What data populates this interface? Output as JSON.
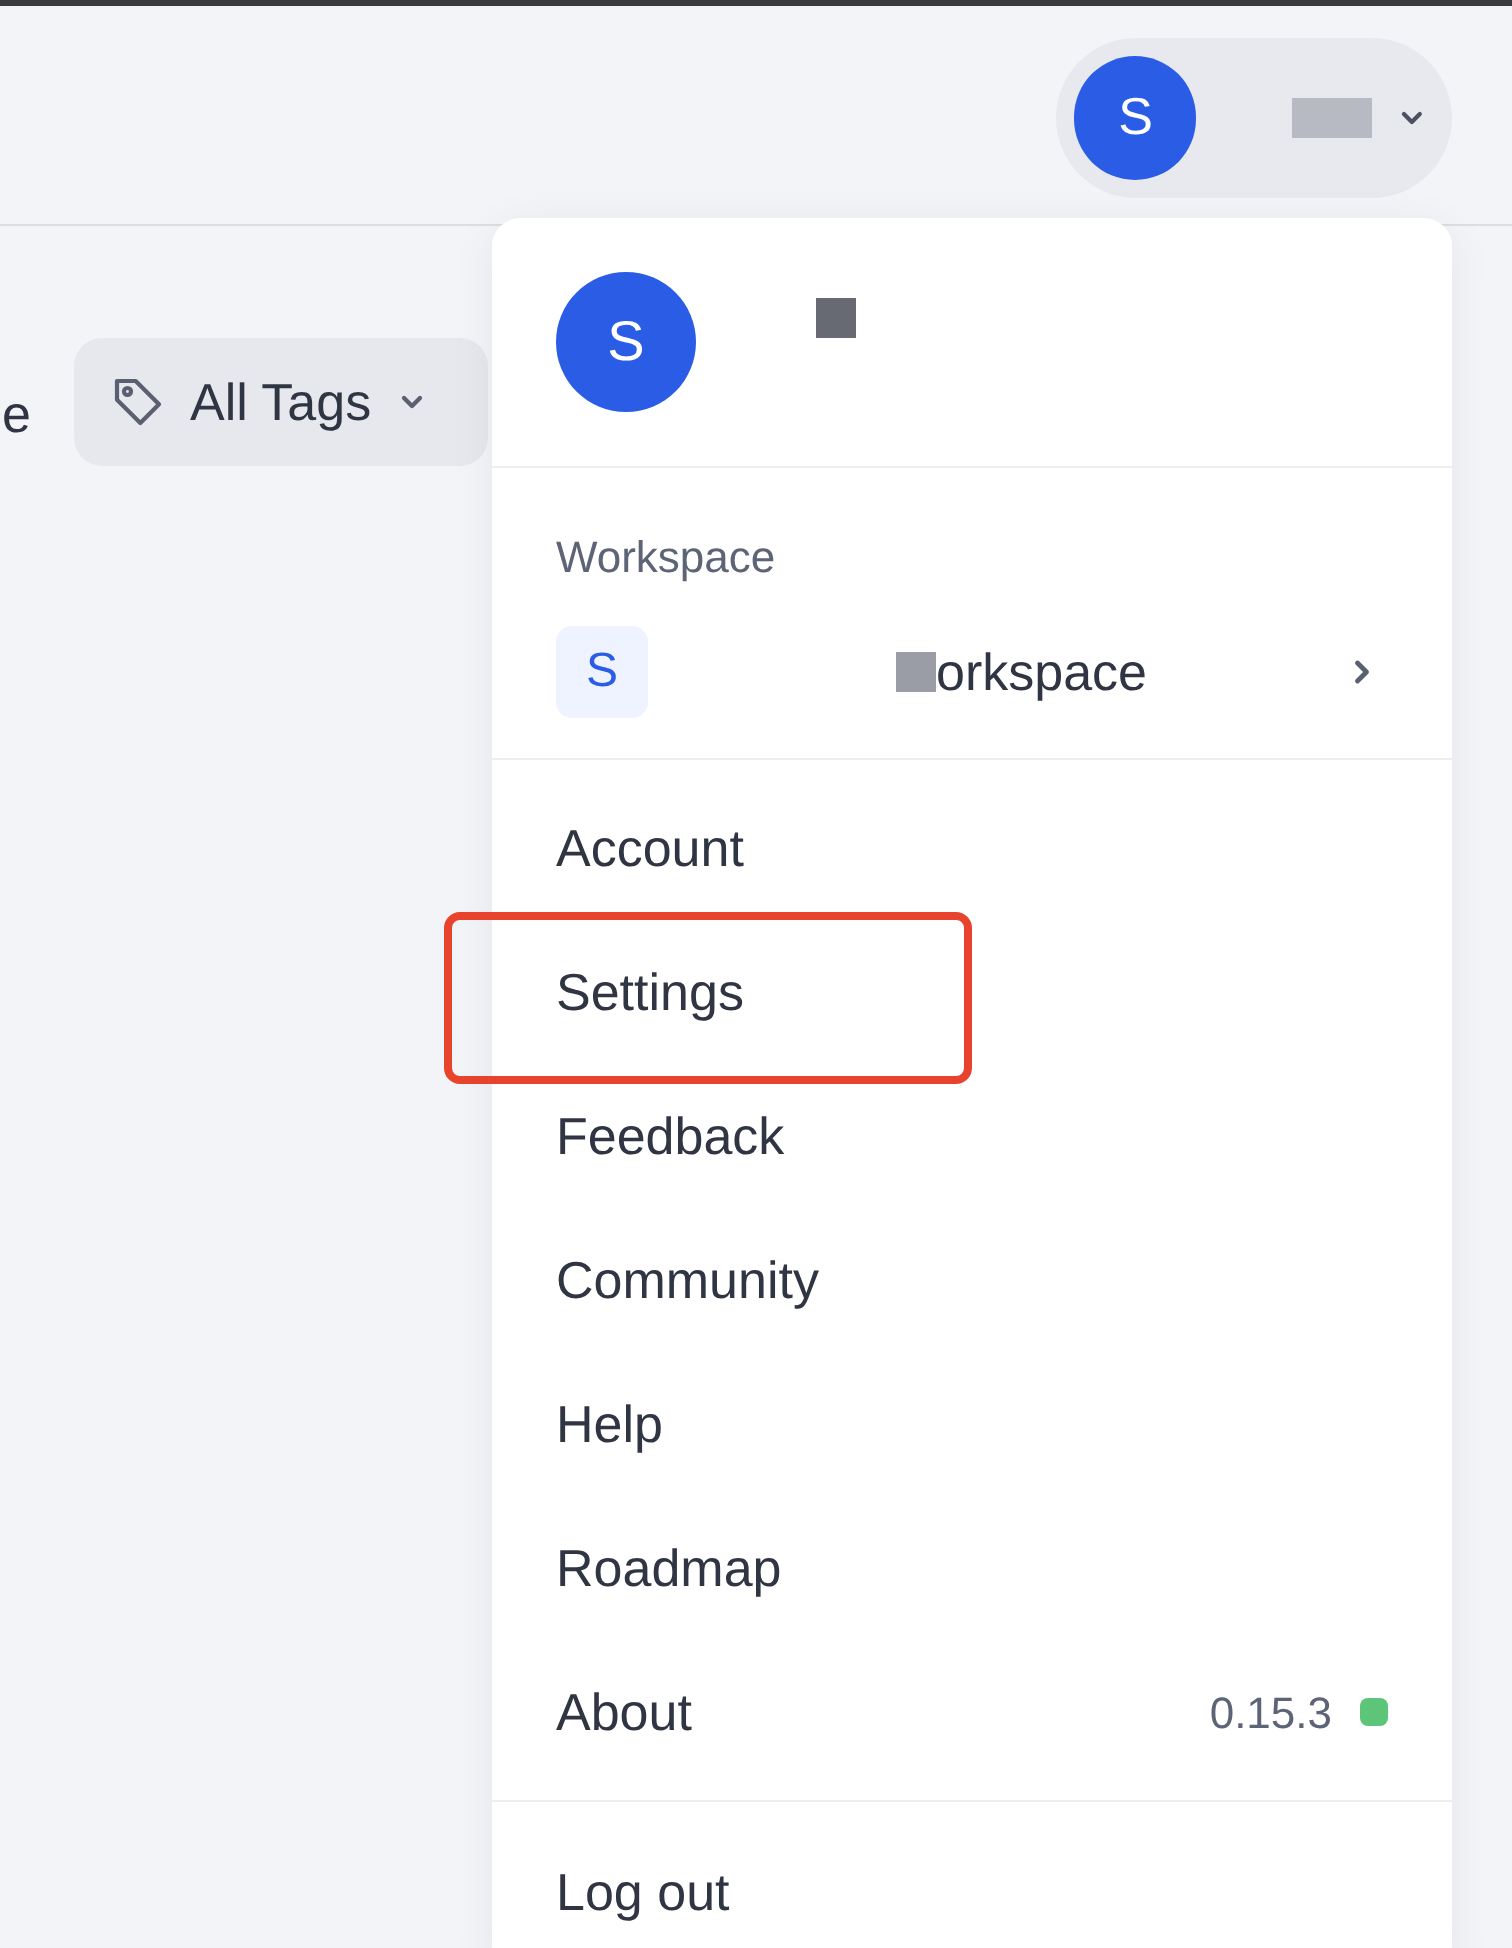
{
  "left_edge_text": "e",
  "tag_filter": {
    "label": "All Tags"
  },
  "profile_button": {
    "avatar_letter": "S"
  },
  "menu": {
    "avatar_letter": "S",
    "workspace_label": "Workspace",
    "workspace": {
      "letter": "S",
      "name": "orkspace"
    },
    "items": [
      {
        "label": "Account",
        "highlighted": false
      },
      {
        "label": "Settings",
        "highlighted": true
      },
      {
        "label": "Feedback",
        "highlighted": false
      },
      {
        "label": "Community",
        "highlighted": false
      },
      {
        "label": "Help",
        "highlighted": false
      },
      {
        "label": "Roadmap",
        "highlighted": false
      },
      {
        "label": "About",
        "highlighted": false,
        "version": "0.15.3",
        "color": "#5cc57a"
      }
    ],
    "logout": "Log out"
  }
}
